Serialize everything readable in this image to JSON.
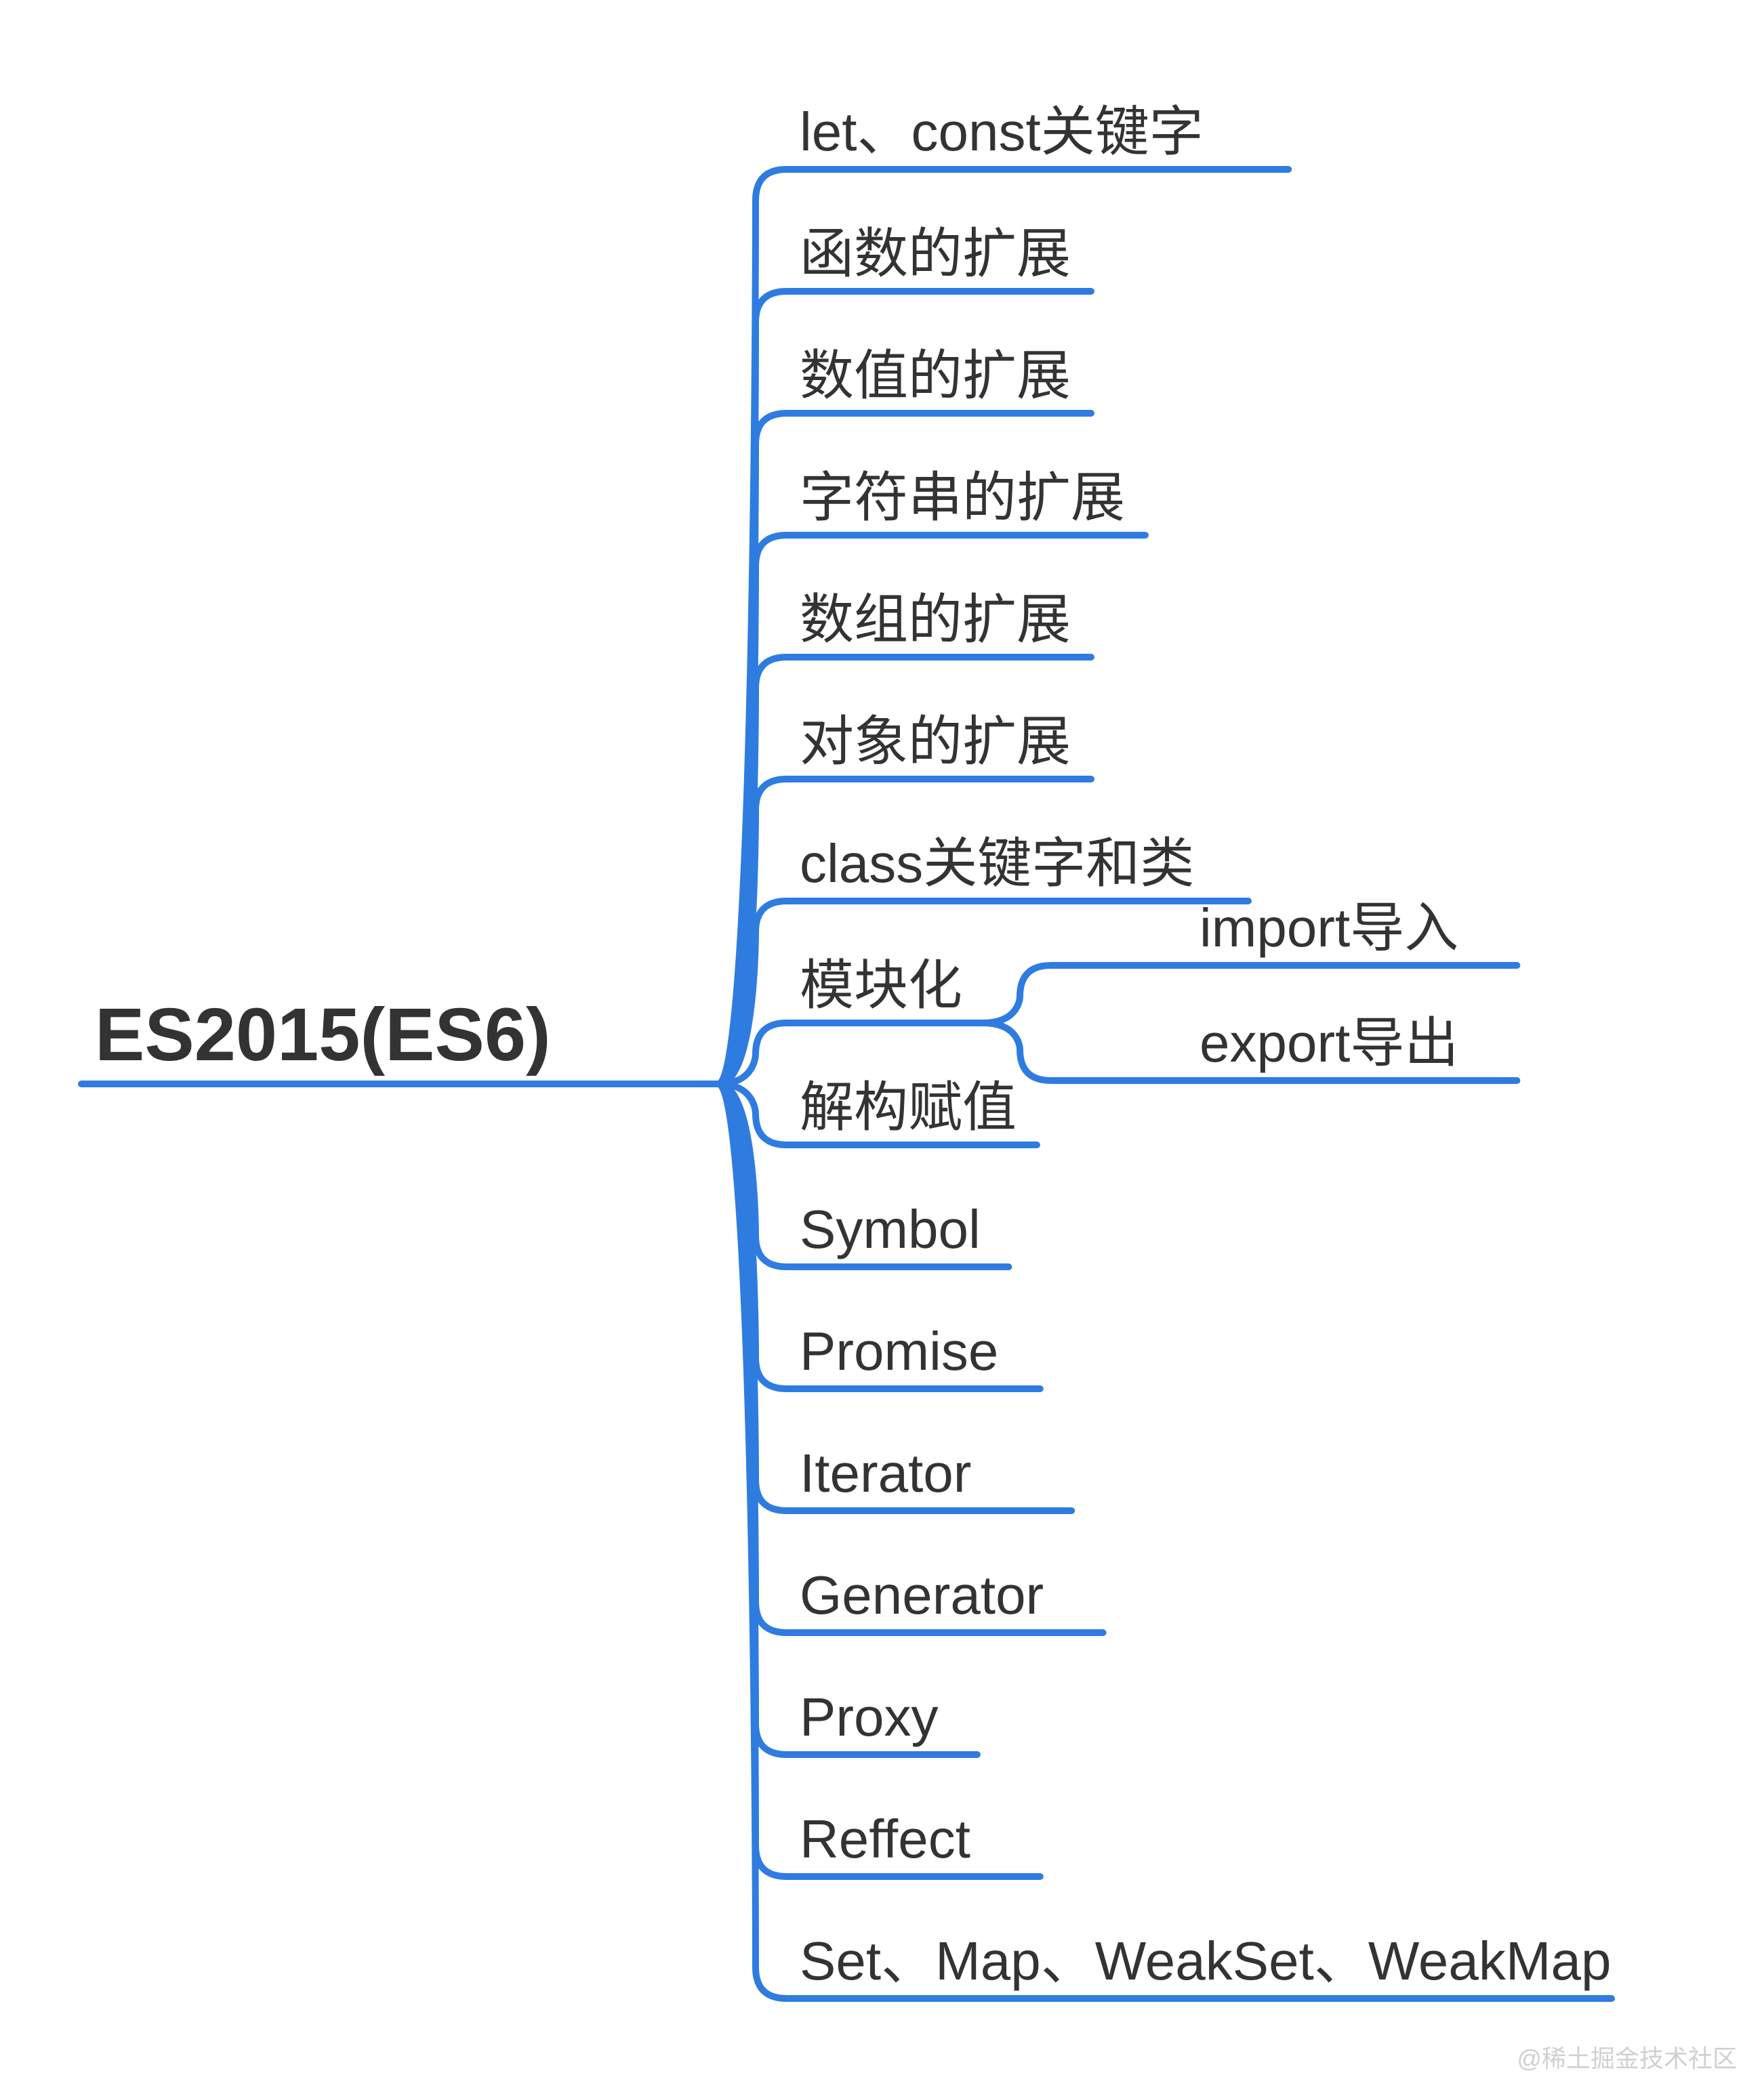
{
  "colors": {
    "line": "#2f7ce0",
    "text": "#333333",
    "bg": "#ffffff"
  },
  "root": {
    "label": "ES2015(ES6)"
  },
  "children": [
    {
      "label": "let、const关键字"
    },
    {
      "label": "函数的扩展"
    },
    {
      "label": "数值的扩展"
    },
    {
      "label": "字符串的扩展"
    },
    {
      "label": "数组的扩展"
    },
    {
      "label": "对象的扩展"
    },
    {
      "label": "class关键字和类"
    },
    {
      "label": "模块化",
      "children": [
        {
          "label": "import导入"
        },
        {
          "label": "export导出"
        }
      ]
    },
    {
      "label": "解构赋值"
    },
    {
      "label": "Symbol"
    },
    {
      "label": "Promise"
    },
    {
      "label": "Iterator"
    },
    {
      "label": "Generator"
    },
    {
      "label": "Proxy"
    },
    {
      "label": "Reffect"
    },
    {
      "label": "Set、Map、WeakSet、WeakMap"
    }
  ],
  "watermark": "@稀土掘金技术社区"
}
